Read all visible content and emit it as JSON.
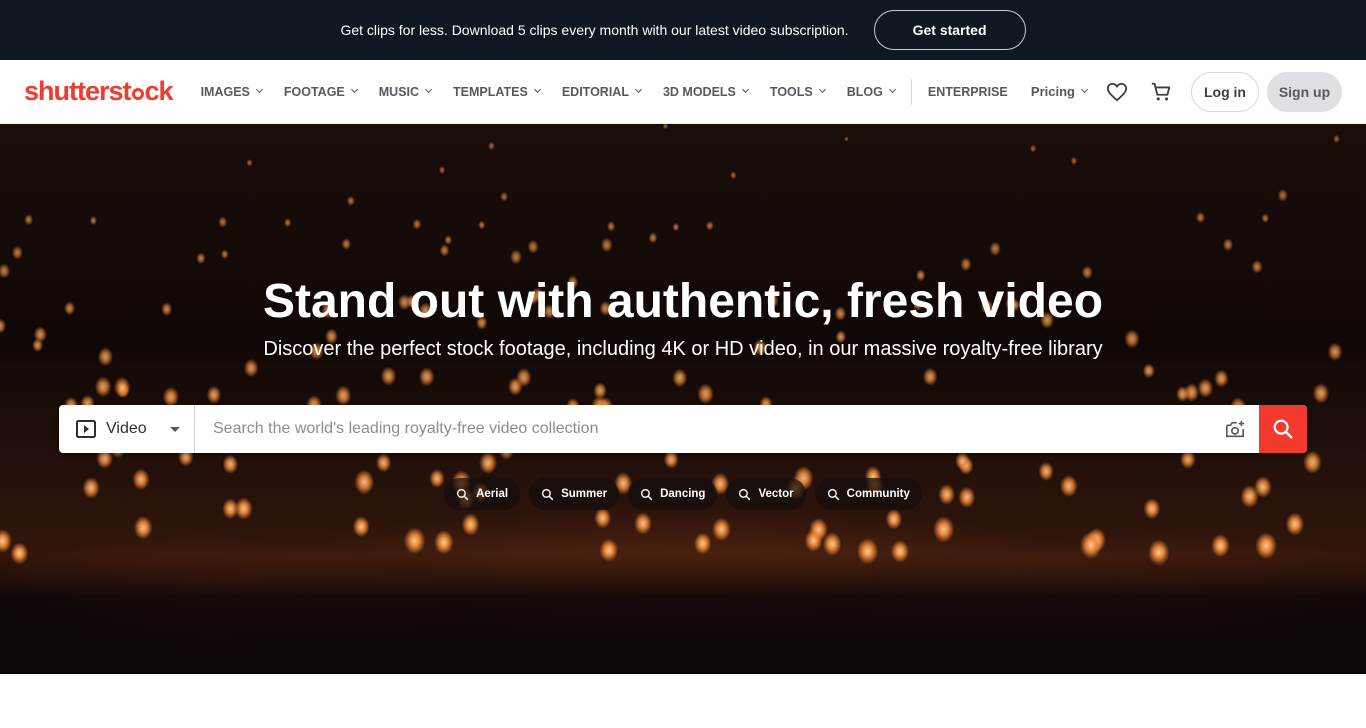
{
  "promo": {
    "text": "Get clips for less. Download 5 clips every month with our latest video subscription.",
    "button": "Get started"
  },
  "header": {
    "logo": {
      "part1": "shutterst",
      "part2": "ck"
    },
    "nav": [
      {
        "label": "IMAGES"
      },
      {
        "label": "FOOTAGE"
      },
      {
        "label": "MUSIC"
      },
      {
        "label": "TEMPLATES"
      },
      {
        "label": "EDITORIAL"
      },
      {
        "label": "3D MODELS"
      },
      {
        "label": "TOOLS"
      },
      {
        "label": "BLOG"
      }
    ],
    "enterprise": "ENTERPRISE",
    "pricing": "Pricing",
    "login": "Log in",
    "signup": "Sign up"
  },
  "hero": {
    "title": "Stand out with authentic, fresh video",
    "subtitle": "Discover the perfect stock footage, including 4K or HD video, in our massive royalty-free library",
    "search": {
      "type": "Video",
      "placeholder": "Search the world's leading royalty-free video collection"
    },
    "chips": [
      {
        "label": "Aerial"
      },
      {
        "label": "Summer"
      },
      {
        "label": "Dancing"
      },
      {
        "label": "Vector"
      },
      {
        "label": "Community"
      }
    ]
  },
  "colors": {
    "brand": "#f23a2f",
    "banner_bg": "#0f1723"
  }
}
